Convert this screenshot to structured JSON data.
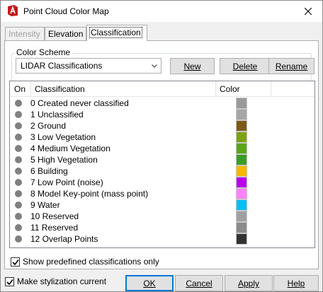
{
  "window": {
    "title": "Point Cloud Color Map"
  },
  "tabs": [
    {
      "label": "Intensity",
      "state": "disabled"
    },
    {
      "label": "Elevation",
      "state": "normal"
    },
    {
      "label": "Classification",
      "state": "active"
    }
  ],
  "color_scheme": {
    "group_label": "Color Scheme",
    "selected": "LIDAR Classifications",
    "new_label": "New",
    "delete_label": "Delete",
    "rename_label": "Rename"
  },
  "list": {
    "columns": [
      "On",
      "Classification",
      "Color"
    ],
    "rows": [
      {
        "label": "0 Created never classified",
        "color": "#9a9a9a"
      },
      {
        "label": "1 Unclassified",
        "color": "#a6a6a6"
      },
      {
        "label": "2 Ground",
        "color": "#7f5a13"
      },
      {
        "label": "3 Low Vegetation",
        "color": "#7aa40f"
      },
      {
        "label": "4 Medium Vegetation",
        "color": "#5aa617"
      },
      {
        "label": "5 High Vegetation",
        "color": "#3a9d26"
      },
      {
        "label": "6 Building",
        "color": "#f5b700"
      },
      {
        "label": "7 Low Point (noise)",
        "color": "#b900ef"
      },
      {
        "label": "8 Model Key-point (mass point)",
        "color": "#ff80ff"
      },
      {
        "label": "9 Water",
        "color": "#00c0f5"
      },
      {
        "label": "10 Reserved",
        "color": "#a0a0a0"
      },
      {
        "label": "11 Reserved",
        "color": "#8c8c8c"
      },
      {
        "label": "12 Overlap Points",
        "color": "#333333"
      }
    ]
  },
  "show_predefined": {
    "label": "Show predefined classifications only",
    "checked": true
  },
  "footer": {
    "make_current": {
      "label": "Make stylization current",
      "checked": true
    },
    "ok_label": "OK",
    "cancel_label": "Cancel",
    "apply_label": "Apply",
    "help_label": "Help"
  },
  "icons": {
    "title": "autocad-logo-icon",
    "close": "close-icon",
    "dropdown": "chevron-down-icon",
    "status": "status-dot-icon"
  }
}
